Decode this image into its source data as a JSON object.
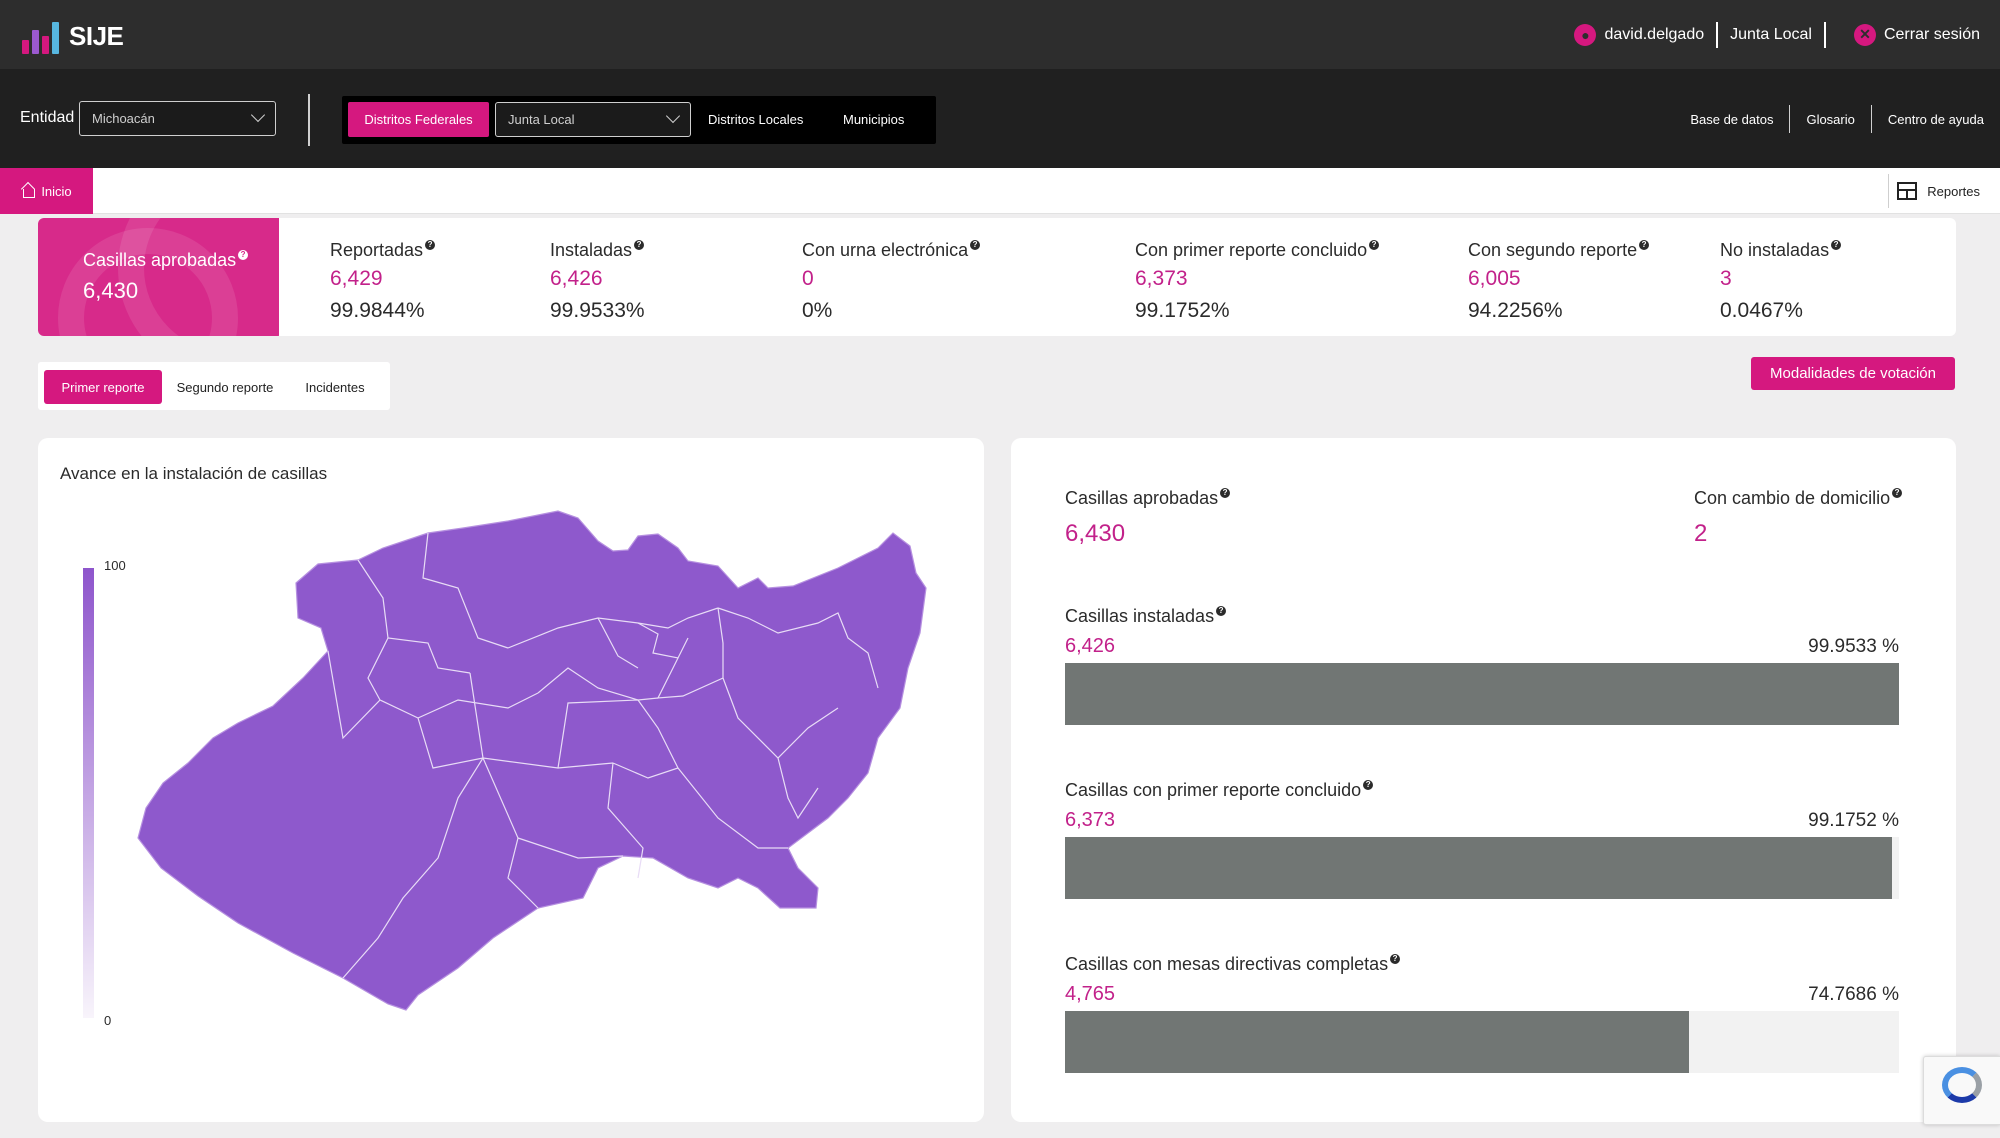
{
  "app": {
    "name": "SIJE",
    "user": "david.delgado",
    "role": "Junta Local",
    "logout": "Cerrar sesión"
  },
  "filters": {
    "entidad_label": "Entidad",
    "entidad_value": "Michoacán",
    "segments": [
      "Distritos Federales",
      "Junta Local",
      "Distritos Locales",
      "Municipios"
    ],
    "links": [
      "Base de datos",
      "Glosario",
      "Centro de ayuda"
    ]
  },
  "breadcrumb": {
    "home": "Inicio",
    "reportes": "Reportes"
  },
  "summary": {
    "hero_label": "Casillas aprobadas",
    "hero_value": "6,430",
    "stats": [
      {
        "label": "Reportadas",
        "value": "6,429",
        "pct": "99.9844%"
      },
      {
        "label": "Instaladas",
        "value": "6,426",
        "pct": "99.9533%"
      },
      {
        "label": "Con urna electrónica",
        "value": "0",
        "pct": "0%"
      },
      {
        "label": "Con primer reporte concluido",
        "value": "6,373",
        "pct": "99.1752%"
      },
      {
        "label": "Con segundo reporte",
        "value": "6,005",
        "pct": "94.2256%"
      },
      {
        "label": "No instaladas",
        "value": "3",
        "pct": "0.0467%"
      }
    ]
  },
  "tabs": [
    "Primer reporte",
    "Segundo reporte",
    "Incidentes"
  ],
  "modalidades_button": "Modalidades de votación",
  "map": {
    "title": "Avance en la instalación de casillas",
    "legend_max": "100",
    "legend_min": "0",
    "fill_color": "#8e59cc"
  },
  "panel": {
    "aprobadas_label": "Casillas aprobadas",
    "aprobadas_value": "6,430",
    "cambio_label": "Con cambio de domicilio",
    "cambio_value": "2",
    "bars": [
      {
        "label": "Casillas instaladas",
        "value": "6,426",
        "pct": "99.9533 %",
        "fraction": 0.999533
      },
      {
        "label": "Casillas con primer reporte concluido",
        "value": "6,373",
        "pct": "99.1752 %",
        "fraction": 0.991752
      },
      {
        "label": "Casillas con mesas directivas completas",
        "value": "4,765",
        "pct": "74.7686 %",
        "fraction": 0.747686
      }
    ]
  },
  "colors": {
    "brand": "#d5187f",
    "topbar": "#2d2d2d",
    "bar_fill": "#717674",
    "map_fill": "#8e59cc"
  }
}
